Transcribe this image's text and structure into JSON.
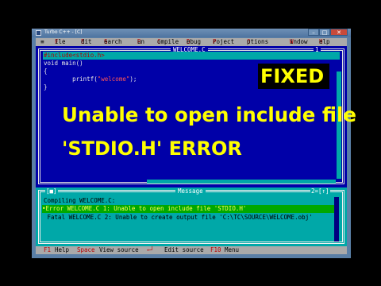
{
  "window": {
    "title": "Turbo C++ - [C]",
    "controls": {
      "minimize": "–",
      "maximize": "□",
      "close": "✕"
    }
  },
  "menu": {
    "system": "≡",
    "items": [
      {
        "label": "File",
        "hot": "F",
        "rest": "ile"
      },
      {
        "label": "Edit",
        "hot": "E",
        "rest": "dit"
      },
      {
        "label": "Search",
        "hot": "S",
        "rest": "earch"
      },
      {
        "label": "Run",
        "hot": "R",
        "rest": "un"
      },
      {
        "label": "Compile",
        "hot": "C",
        "rest": "ompile"
      },
      {
        "label": "Debug",
        "hot": "D",
        "rest": "ebug"
      },
      {
        "label": "Project",
        "hot": "P",
        "rest": "roject"
      },
      {
        "label": "Options",
        "hot": "O",
        "rest": "ptions"
      },
      {
        "label": "Window",
        "hot": "W",
        "rest": "indow"
      },
      {
        "label": "Help",
        "hot": "H",
        "rest": "elp"
      }
    ]
  },
  "editor": {
    "title": "WELCOME.C",
    "window_number": "1",
    "lines": [
      "#include<stdio.h>",
      "void main()",
      "{",
      "        printf(\"welcome\");",
      "}"
    ],
    "printf_prefix": "        printf(",
    "printf_string": "\"welcome\"",
    "printf_suffix": ");"
  },
  "overlay": {
    "badge": "FIXED",
    "headline_1": "Unable to open include file",
    "headline_2": "'STDIO.H' ERROR"
  },
  "messages": {
    "title": "Message",
    "left_control": "[■]",
    "right_control": "2=[↑]",
    "lines": [
      "Compiling WELCOME.C:",
      "•Error WELCOME.C 1: Unable to open include file 'STDIO.H'",
      " Fatal WELCOME.C 2: Unable to create output file 'C:\\TC\\SOURCE\\WELCOME.obj'"
    ]
  },
  "status": {
    "f1_key": "F1",
    "f1_label": "Help",
    "space_key": "Space",
    "space_label": "View source",
    "enter_key": "←┘",
    "enter_label": "Edit source",
    "f10_key": "F10",
    "f10_label": "Menu"
  },
  "colors": {
    "editor_bg": "#0000a8",
    "message_bg": "#00a8a8",
    "menu_bg": "#aaaaaa",
    "overlay_text": "#ffff00"
  }
}
